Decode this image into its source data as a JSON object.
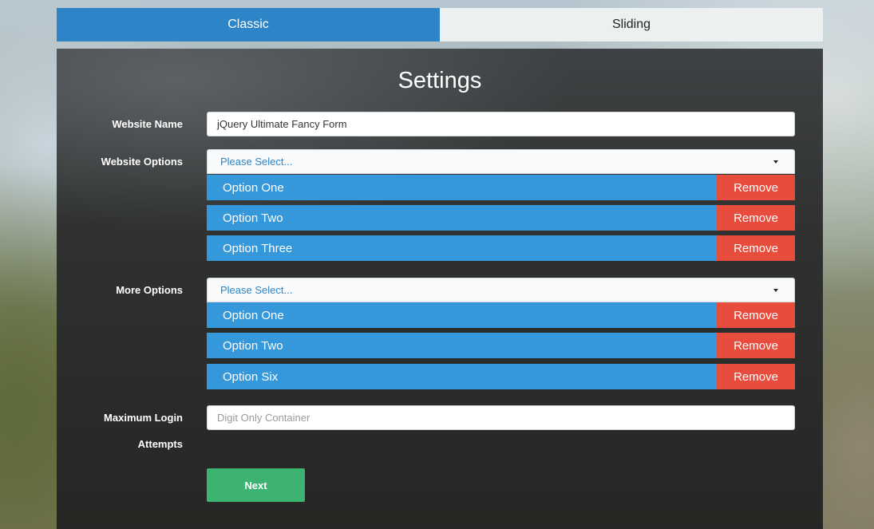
{
  "tabs": [
    {
      "label": "Classic",
      "active": true
    },
    {
      "label": "Sliding",
      "active": false
    }
  ],
  "form": {
    "title": "Settings",
    "website_name": {
      "label": "Website Name",
      "value": "jQuery Ultimate Fancy Form"
    },
    "website_options": {
      "label": "Website Options",
      "placeholder": "Please Select...",
      "selected": [
        {
          "label": "Option One",
          "remove": "Remove"
        },
        {
          "label": "Option Two",
          "remove": "Remove"
        },
        {
          "label": "Option Three",
          "remove": "Remove"
        }
      ]
    },
    "more_options": {
      "label": "More Options",
      "placeholder": "Please Select...",
      "selected": [
        {
          "label": "Option One",
          "remove": "Remove"
        },
        {
          "label": "Option Two",
          "remove": "Remove"
        },
        {
          "label": "Option Six",
          "remove": "Remove"
        }
      ]
    },
    "max_login": {
      "label_line1": "Maximum Login",
      "label_line2": "Attempts",
      "placeholder": "Digit Only Container"
    },
    "next_label": "Next"
  },
  "colors": {
    "tab_active": "#2d84c6",
    "option_blue": "#3498db",
    "remove_red": "#e74c3c",
    "next_green": "#3cb371"
  }
}
